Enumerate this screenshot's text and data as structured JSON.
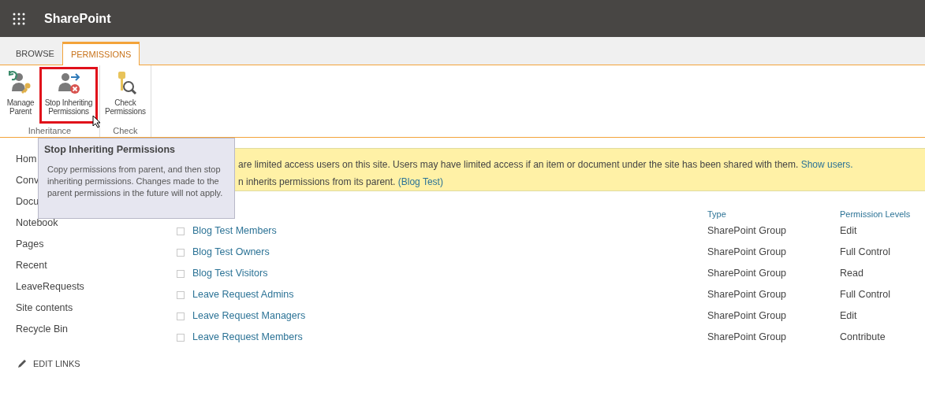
{
  "app_bar": {
    "title": "SharePoint"
  },
  "ribbon_tabs": [
    {
      "label": "BROWSE",
      "selected": false
    },
    {
      "label": "PERMISSIONS",
      "selected": true
    }
  ],
  "ribbon_groups": [
    {
      "label": "Inheritance",
      "buttons": [
        {
          "label": "Manage Parent",
          "kind": "manage",
          "highlighted": false
        },
        {
          "label": "Stop Inheriting Permissions",
          "kind": "stop",
          "highlighted": true
        }
      ]
    },
    {
      "label": "Check",
      "buttons": [
        {
          "label": "Check Permissions",
          "kind": "check",
          "highlighted": false
        }
      ]
    }
  ],
  "tooltip": {
    "title": "Stop Inheriting Permissions",
    "body": "Copy permissions from parent, and then stop inheriting permissions. Changes made to the parent permissions in the future will not apply."
  },
  "sidebar": {
    "items": [
      "Hom",
      "Conv",
      "Docu",
      "Notebook",
      "Pages",
      "Recent",
      "LeaveRequests",
      "Site contents",
      "Recycle Bin"
    ],
    "edit_links": "EDIT LINKS"
  },
  "banner": {
    "line_1": "are limited access users on this site. Users may have limited access if an item or document under the site has been shared with them.",
    "line_1_link": "Show users.",
    "line_2": "n inherits permissions from its parent.",
    "line_2_link": "(Blog Test)"
  },
  "table": {
    "columns": [
      "Type",
      "Permission Levels"
    ],
    "rows": [
      {
        "name": "Blog Test Members",
        "type": "SharePoint Group",
        "level": "Edit",
        "checked": false
      },
      {
        "name": "Blog Test Owners",
        "type": "SharePoint Group",
        "level": "Full Control",
        "checked": false
      },
      {
        "name": "Blog Test Visitors",
        "type": "SharePoint Group",
        "level": "Read",
        "checked": false
      },
      {
        "name": "Leave Request Admins",
        "type": "SharePoint Group",
        "level": "Full Control",
        "checked": false
      },
      {
        "name": "Leave Request Managers",
        "type": "SharePoint Group",
        "level": "Edit",
        "checked": false
      },
      {
        "name": "Leave Request Members",
        "type": "SharePoint Group",
        "level": "Contribute",
        "checked": false
      }
    ]
  }
}
